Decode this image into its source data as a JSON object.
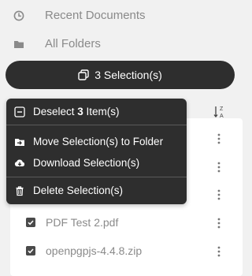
{
  "nav": {
    "recent_label": "Recent Documents",
    "folders_label": "All Folders"
  },
  "selection_button": {
    "count": "3",
    "label_suffix": " Selection(s)"
  },
  "context_menu": {
    "deselect_prefix": "Deselect ",
    "deselect_count": "3",
    "deselect_suffix": " Item(s)",
    "move_label": "Move Selection(s) to Folder",
    "download_label": "Download Selection(s)",
    "delete_label": "Delete Selection(s)"
  },
  "files": [
    {
      "name": "PDF Test 2.pdf",
      "checked": true
    },
    {
      "name": "openpgpjs-4.4.8.zip",
      "checked": true
    }
  ],
  "icons": {
    "recent": "clock-icon",
    "folders": "folder-icon",
    "selection": "copy-icon",
    "sort": "sort-alpha-icon",
    "deselect": "minus-square-icon",
    "move": "folder-move-icon",
    "download": "cloud-download-icon",
    "delete": "trash-icon",
    "row_menu": "kebab-icon"
  },
  "colors": {
    "background": "#f1f1f1",
    "dark": "#2e2e2e",
    "muted_text": "#8a8a8a"
  }
}
